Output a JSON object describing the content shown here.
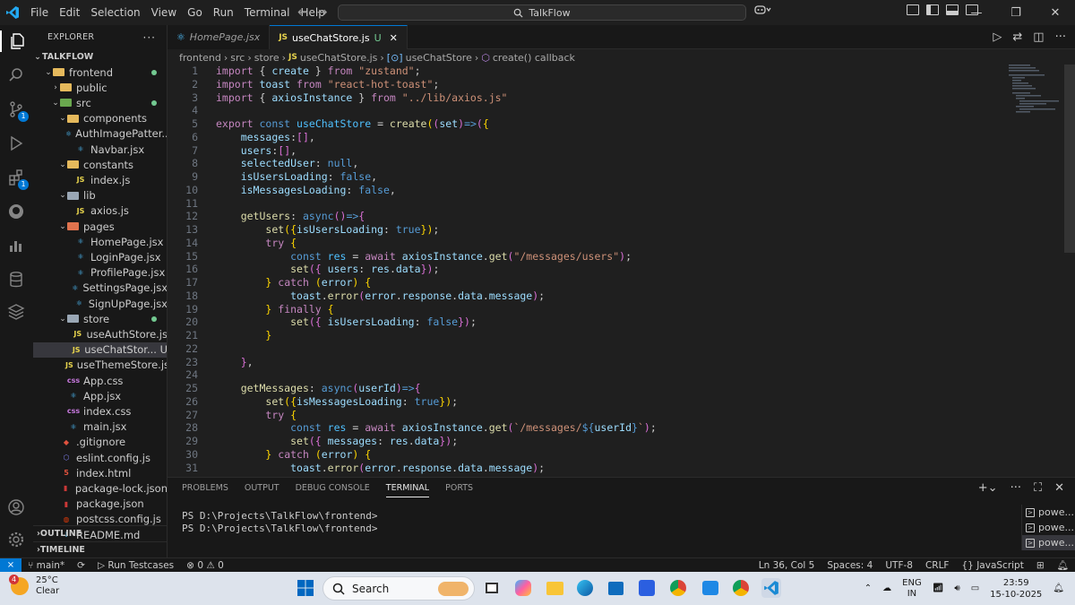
{
  "titlebar": {
    "menu": [
      "File",
      "Edit",
      "Selection",
      "View",
      "Go",
      "Run",
      "Terminal",
      "Help"
    ],
    "search_text": "TalkFlow"
  },
  "sidebar": {
    "header": "EXPLORER",
    "project": "TALKFLOW",
    "rows": [
      {
        "label": "frontend",
        "kind": "folder-open",
        "depth": 1,
        "dot": true,
        "color": "#e5b95c"
      },
      {
        "label": "public",
        "kind": "folder",
        "depth": 2,
        "dot": false,
        "color": "#e5b95c"
      },
      {
        "label": "src",
        "kind": "folder-open",
        "depth": 2,
        "dot": true,
        "color": "#6aa84f"
      },
      {
        "label": "components",
        "kind": "folder-open",
        "depth": 3,
        "dot": false,
        "color": "#e5b95c"
      },
      {
        "label": "AuthImagePatter...",
        "kind": "react",
        "depth": 4,
        "dot": false,
        "color": "#4fc1ff"
      },
      {
        "label": "Navbar.jsx",
        "kind": "react",
        "depth": 4,
        "dot": false,
        "color": "#4fc1ff"
      },
      {
        "label": "constants",
        "kind": "folder-open",
        "depth": 3,
        "dot": false,
        "color": "#e5b95c"
      },
      {
        "label": "index.js",
        "kind": "js",
        "depth": 4,
        "dot": false,
        "color": "#e8d44d"
      },
      {
        "label": "lib",
        "kind": "folder-open",
        "depth": 3,
        "dot": false,
        "color": "#9aa7b5"
      },
      {
        "label": "axios.js",
        "kind": "js",
        "depth": 4,
        "dot": false,
        "color": "#e8d44d"
      },
      {
        "label": "pages",
        "kind": "folder-open",
        "depth": 3,
        "dot": false,
        "color": "#e0734e"
      },
      {
        "label": "HomePage.jsx",
        "kind": "react",
        "depth": 4,
        "dot": false,
        "color": "#4fc1ff"
      },
      {
        "label": "LoginPage.jsx",
        "kind": "react",
        "depth": 4,
        "dot": false,
        "color": "#4fc1ff"
      },
      {
        "label": "ProfilePage.jsx",
        "kind": "react",
        "depth": 4,
        "dot": false,
        "color": "#4fc1ff"
      },
      {
        "label": "SettingsPage.jsx",
        "kind": "react",
        "depth": 4,
        "dot": false,
        "color": "#4fc1ff"
      },
      {
        "label": "SignUpPage.jsx",
        "kind": "react",
        "depth": 4,
        "dot": false,
        "color": "#4fc1ff"
      },
      {
        "label": "store",
        "kind": "folder-open",
        "depth": 3,
        "dot": true,
        "color": "#9aa7b5"
      },
      {
        "label": "useAuthStore.js",
        "kind": "js",
        "depth": 4,
        "dot": false,
        "color": "#e8d44d"
      },
      {
        "label": "useChatStor... U",
        "kind": "js",
        "depth": 4,
        "dot": false,
        "color": "#e8d44d",
        "selected": true
      },
      {
        "label": "useThemeStore.js",
        "kind": "js",
        "depth": 4,
        "dot": false,
        "color": "#e8d44d"
      },
      {
        "label": "App.css",
        "kind": "css",
        "depth": 3,
        "dot": false,
        "color": "#c678dd"
      },
      {
        "label": "App.jsx",
        "kind": "react",
        "depth": 3,
        "dot": false,
        "color": "#4fc1ff"
      },
      {
        "label": "index.css",
        "kind": "css",
        "depth": 3,
        "dot": false,
        "color": "#c678dd"
      },
      {
        "label": "main.jsx",
        "kind": "react",
        "depth": 3,
        "dot": false,
        "color": "#4fc1ff"
      },
      {
        "label": ".gitignore",
        "kind": "git",
        "depth": 2,
        "dot": false,
        "color": "#e0523e"
      },
      {
        "label": "eslint.config.js",
        "kind": "eslint",
        "depth": 2,
        "dot": false,
        "color": "#8080f2"
      },
      {
        "label": "index.html",
        "kind": "html",
        "depth": 2,
        "dot": false,
        "color": "#e0523e"
      },
      {
        "label": "package-lock.json",
        "kind": "npm",
        "depth": 2,
        "dot": false,
        "color": "#cb3837"
      },
      {
        "label": "package.json",
        "kind": "npm",
        "depth": 2,
        "dot": false,
        "color": "#cb3837"
      },
      {
        "label": "postcss.config.js",
        "kind": "postcss",
        "depth": 2,
        "dot": false,
        "color": "#dd3a0a"
      },
      {
        "label": "README.md",
        "kind": "md",
        "depth": 2,
        "dot": false,
        "color": "#519aba"
      }
    ],
    "outline": "OUTLINE",
    "timeline": "TIMELINE"
  },
  "tabs": [
    {
      "label": "HomePage.jsx",
      "active": false
    },
    {
      "label": "useChatStore.js",
      "active": true,
      "modifier": "U"
    }
  ],
  "breadcrumbs": [
    "frontend",
    "src",
    "store",
    "useChatStore.js",
    "useChatStore",
    "create() callback"
  ],
  "code_lines": [
    "<span class='kc'>import</span> { <span class='v'>create</span> } <span class='kc'>from</span> <span class='s'>\"zustand\"</span>;",
    "<span class='kc'>import</span> <span class='v'>toast</span> <span class='kc'>from</span> <span class='s'>\"react-hot-toast\"</span>;",
    "<span class='kc'>import</span> { <span class='v'>axiosInstance</span> } <span class='kc'>from</span> <span class='s'>\"../lib/axios.js\"</span>",
    "",
    "<span class='kc'>export</span> <span class='k'>const</span> <span class='c'>useChatStore</span> = <span class='f'>create</span><span class='b'>(</span><span class='p'>(</span><span class='v'>set</span><span class='p'>)</span><span class='k'>=&gt;</span><span class='p'>(</span><span class='b'>{</span>",
    "    <span class='v'>messages</span>:<span class='p'>[]</span>,",
    "    <span class='v'>users</span>:<span class='p'>[]</span>,",
    "    <span class='v'>selectedUser</span>: <span class='k'>null</span>,",
    "    <span class='v'>isUsersLoading</span>: <span class='k'>false</span>,",
    "    <span class='v'>isMessagesLoading</span>: <span class='k'>false</span>,",
    "",
    "    <span class='f'>getUsers</span>: <span class='k'>async</span><span class='p'>()</span><span class='k'>=&gt;</span><span class='p'>{</span>",
    "        <span class='f'>set</span><span class='b'>({</span><span class='v'>isUsersLoading</span>: <span class='k'>true</span><span class='b'>})</span>;",
    "        <span class='kc'>try</span> <span class='b'>{</span>",
    "            <span class='k'>const</span> <span class='c'>res</span> = <span class='kc'>await</span> <span class='v'>axiosInstance</span>.<span class='f'>get</span><span class='p'>(</span><span class='s'>\"/messages/users\"</span><span class='p'>)</span>;",
    "            <span class='f'>set</span><span class='p'>({</span> <span class='v'>users</span>: <span class='v'>res</span>.<span class='v'>data</span><span class='p'>})</span>;",
    "        <span class='b'>}</span> <span class='kc'>catch</span> <span class='b'>(</span><span class='v'>error</span><span class='b'>)</span> <span class='b'>{</span>",
    "            <span class='v'>toast</span>.<span class='f'>error</span><span class='p'>(</span><span class='v'>error</span>.<span class='v'>response</span>.<span class='v'>data</span>.<span class='v'>message</span><span class='p'>)</span>;",
    "        <span class='b'>}</span> <span class='kc'>finally</span> <span class='b'>{</span>",
    "            <span class='f'>set</span><span class='p'>({</span> <span class='v'>isUsersLoading</span>: <span class='k'>false</span><span class='p'>})</span>;",
    "        <span class='b'>}</span>",
    "",
    "    <span class='p'>}</span>,",
    "",
    "    <span class='f'>getMessages</span>: <span class='k'>async</span><span class='p'>(</span><span class='v'>userId</span><span class='p'>)</span><span class='k'>=&gt;</span><span class='p'>{</span>",
    "        <span class='f'>set</span><span class='b'>({</span><span class='v'>isMessagesLoading</span>: <span class='k'>true</span><span class='b'>})</span>;",
    "        <span class='kc'>try</span> <span class='b'>{</span>",
    "            <span class='k'>const</span> <span class='c'>res</span> = <span class='kc'>await</span> <span class='v'>axiosInstance</span>.<span class='f'>get</span><span class='p'>(</span><span class='s'>`/messages/</span><span class='k'>${</span><span class='v'>userId</span><span class='k'>}</span><span class='s'>`</span><span class='p'>)</span>;",
    "            <span class='f'>set</span><span class='p'>({</span> <span class='v'>messages</span>: <span class='v'>res</span>.<span class='v'>data</span><span class='p'>})</span>;",
    "        <span class='b'>}</span> <span class='kc'>catch</span> <span class='b'>(</span><span class='v'>error</span><span class='b'>)</span> <span class='b'>{</span>",
    "            <span class='v'>toast</span>.<span class='f'>error</span><span class='p'>(</span><span class='v'>error</span>.<span class='v'>response</span>.<span class='v'>data</span>.<span class='v'>message</span><span class='p'>)</span>;"
  ],
  "panel": {
    "tabs": [
      "PROBLEMS",
      "OUTPUT",
      "DEBUG CONSOLE",
      "TERMINAL",
      "PORTS"
    ],
    "active_tab": "TERMINAL",
    "terminal_lines": [
      "PS D:\\Projects\\TalkFlow\\frontend>",
      "PS D:\\Projects\\TalkFlow\\frontend>"
    ],
    "terminals": [
      "powe...",
      "powe...",
      "powe..."
    ]
  },
  "statusbar": {
    "branch": "main*",
    "run_testcases": "Run Testcases",
    "errors": "0",
    "warnings": "0",
    "position": "Ln 36, Col 5",
    "spaces": "Spaces: 4",
    "encoding": "UTF-8",
    "eol": "CRLF",
    "language": "JavaScript"
  },
  "taskbar": {
    "weather_temp": "25°C",
    "weather_desc": "Clear",
    "weather_badge": "4",
    "search_placeholder": "Search",
    "lang_top": "ENG",
    "lang_bottom": "IN",
    "time": "23:59",
    "date": "15-10-2025"
  },
  "badges": {
    "source_control": "1",
    "extensions": "1"
  }
}
